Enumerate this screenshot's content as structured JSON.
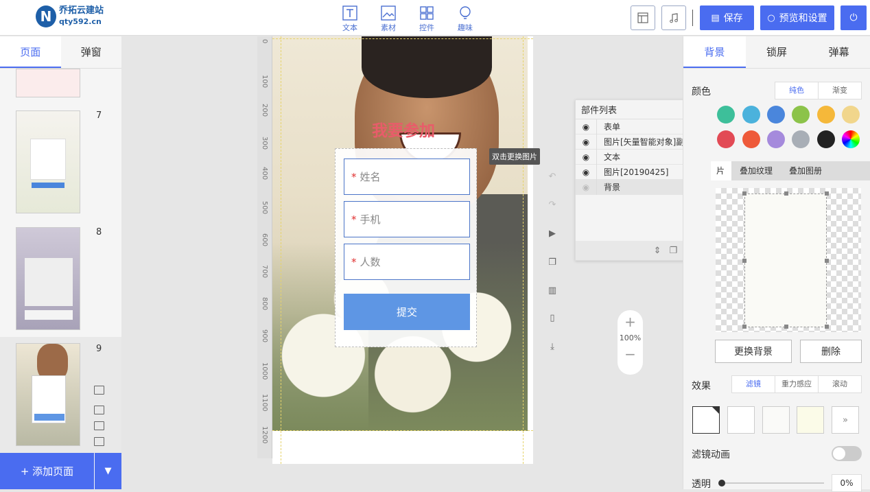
{
  "app": {
    "name": "乔拓云建站",
    "url": "qty592.cn"
  },
  "toolbar": {
    "tools": [
      {
        "label": "文本",
        "icon": "text-icon"
      },
      {
        "label": "素材",
        "icon": "image-icon"
      },
      {
        "label": "控件",
        "icon": "widgets-icon"
      },
      {
        "label": "趣味",
        "icon": "bulb-icon"
      }
    ],
    "save_label": "保存",
    "preview_label": "预览和设置"
  },
  "left": {
    "tabs": [
      "页面",
      "弹窗"
    ],
    "pages": [
      "7",
      "8",
      "9"
    ],
    "add_page": "+ 添加页面"
  },
  "canvas": {
    "ruler": [
      "0",
      "100",
      "200",
      "300",
      "400",
      "500",
      "600",
      "700",
      "800",
      "900",
      "1000",
      "1100",
      "1200"
    ],
    "headline": "我要参加",
    "fields": [
      {
        "req": "*",
        "placeholder": "姓名"
      },
      {
        "req": "*",
        "placeholder": "手机"
      },
      {
        "req": "*",
        "placeholder": "人数"
      }
    ],
    "submit": "提交",
    "tooltip": "双击更换图片",
    "zoom": "100%"
  },
  "components": {
    "title": "部件列表",
    "items": [
      "表单",
      "图片[矢量智能对象]副本",
      "文本",
      "图片[20190425]",
      "背景"
    ]
  },
  "right": {
    "tabs": [
      "背景",
      "锁屏",
      "弹幕"
    ],
    "color_label": "颜色",
    "color_modes": [
      "纯色",
      "渐变"
    ],
    "swatches": [
      "#3dbf9a",
      "#4bb2dc",
      "#4a86dc",
      "#8cc34a",
      "#f5b83a",
      "#f1d68c",
      "#e24a55",
      "#ee5a3a",
      "#a58adc",
      "#a8aeb6",
      "#222222"
    ],
    "subtabs": [
      "片",
      "叠加纹理",
      "叠加图册"
    ],
    "replace_bg": "更换背景",
    "delete": "删除",
    "effect_label": "效果",
    "effect_modes": [
      "滤镜",
      "重力感应",
      "滚动"
    ],
    "filter_anim": "滤镜动画",
    "opacity_label": "透明",
    "opacity_value": "0%"
  }
}
